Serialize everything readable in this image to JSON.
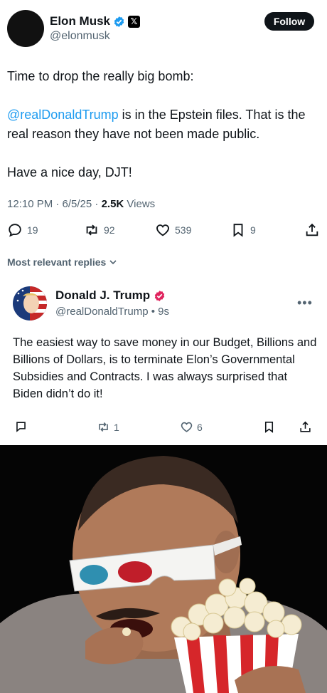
{
  "tweet": {
    "author_name": "Elon Musk",
    "author_handle": "@elonmusk",
    "follow_label": "Follow",
    "line1": "Time to drop the really big bomb:",
    "mention": "@realDonaldTrump",
    "line2_rest": " is in the Epstein files. That is the real reason they have not been made public.",
    "line3": "Have a nice day, DJT!",
    "timestamp": "12:10 PM · 6/5/25 · ",
    "views_count": "2.5K",
    "views_label": " Views",
    "replies": "19",
    "reposts": "92",
    "likes": "539",
    "bookmarks": "9"
  },
  "sort_label": "Most relevant replies",
  "reply": {
    "author_name": "Donald J. Trump",
    "author_handle": "@realDonaldTrump • 9s",
    "text": "The easiest way to save money in our Budget, Billions and Billions of Dollars, is to terminate Elon’s Governmental Subsidies and Contracts. I was always surprised that Biden didn’t do it!",
    "reposts": "1",
    "likes": "6"
  },
  "colors": {
    "accent": "#1d9bf0",
    "muted": "#536471",
    "trump_verified": "#e0245e"
  }
}
